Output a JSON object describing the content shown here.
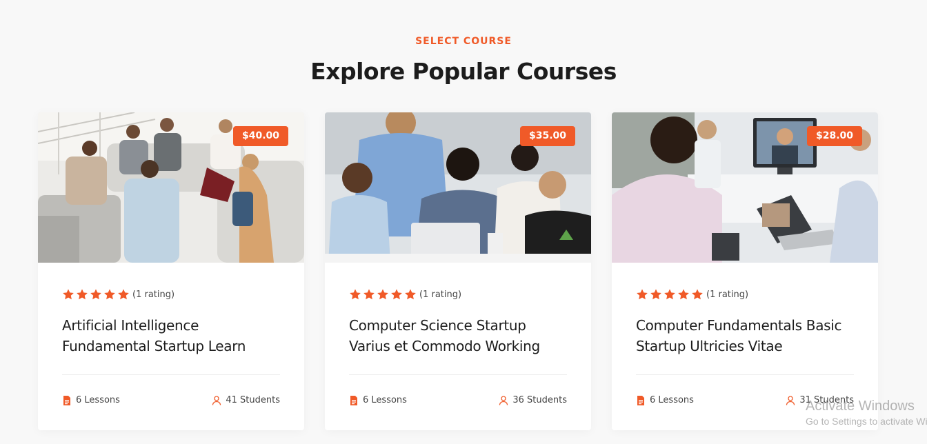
{
  "section": {
    "eyebrow": "SELECT COURSE",
    "title": "Explore Popular Courses"
  },
  "courses": [
    {
      "price": "$40.00",
      "rating_text": "(1 rating)",
      "stars": 5,
      "title": "Artificial Intelligence Fundamental Startup Learn",
      "lessons": "6 Lessons",
      "students": "41 Students",
      "image": "students-group-discussion-photo"
    },
    {
      "price": "$35.00",
      "rating_text": "(1 rating)",
      "stars": 5,
      "title": "Computer Science Startup Varius et Commodo Working",
      "lessons": "6 Lessons",
      "students": "36 Students",
      "image": "students-at-laptop-photo"
    },
    {
      "price": "$28.00",
      "rating_text": "(1 rating)",
      "stars": 5,
      "title": "Computer Fundamentals Basic Startup Ultricies Vitae",
      "lessons": "6 Lessons",
      "students": "31 Students",
      "image": "video-conference-meeting-photo"
    }
  ],
  "watermark": {
    "title": "Activate Windows",
    "subtitle": "Go to Settings to activate Windows."
  },
  "colors": {
    "accent": "#f05a28",
    "background": "#f8f8f8",
    "card": "#ffffff"
  }
}
